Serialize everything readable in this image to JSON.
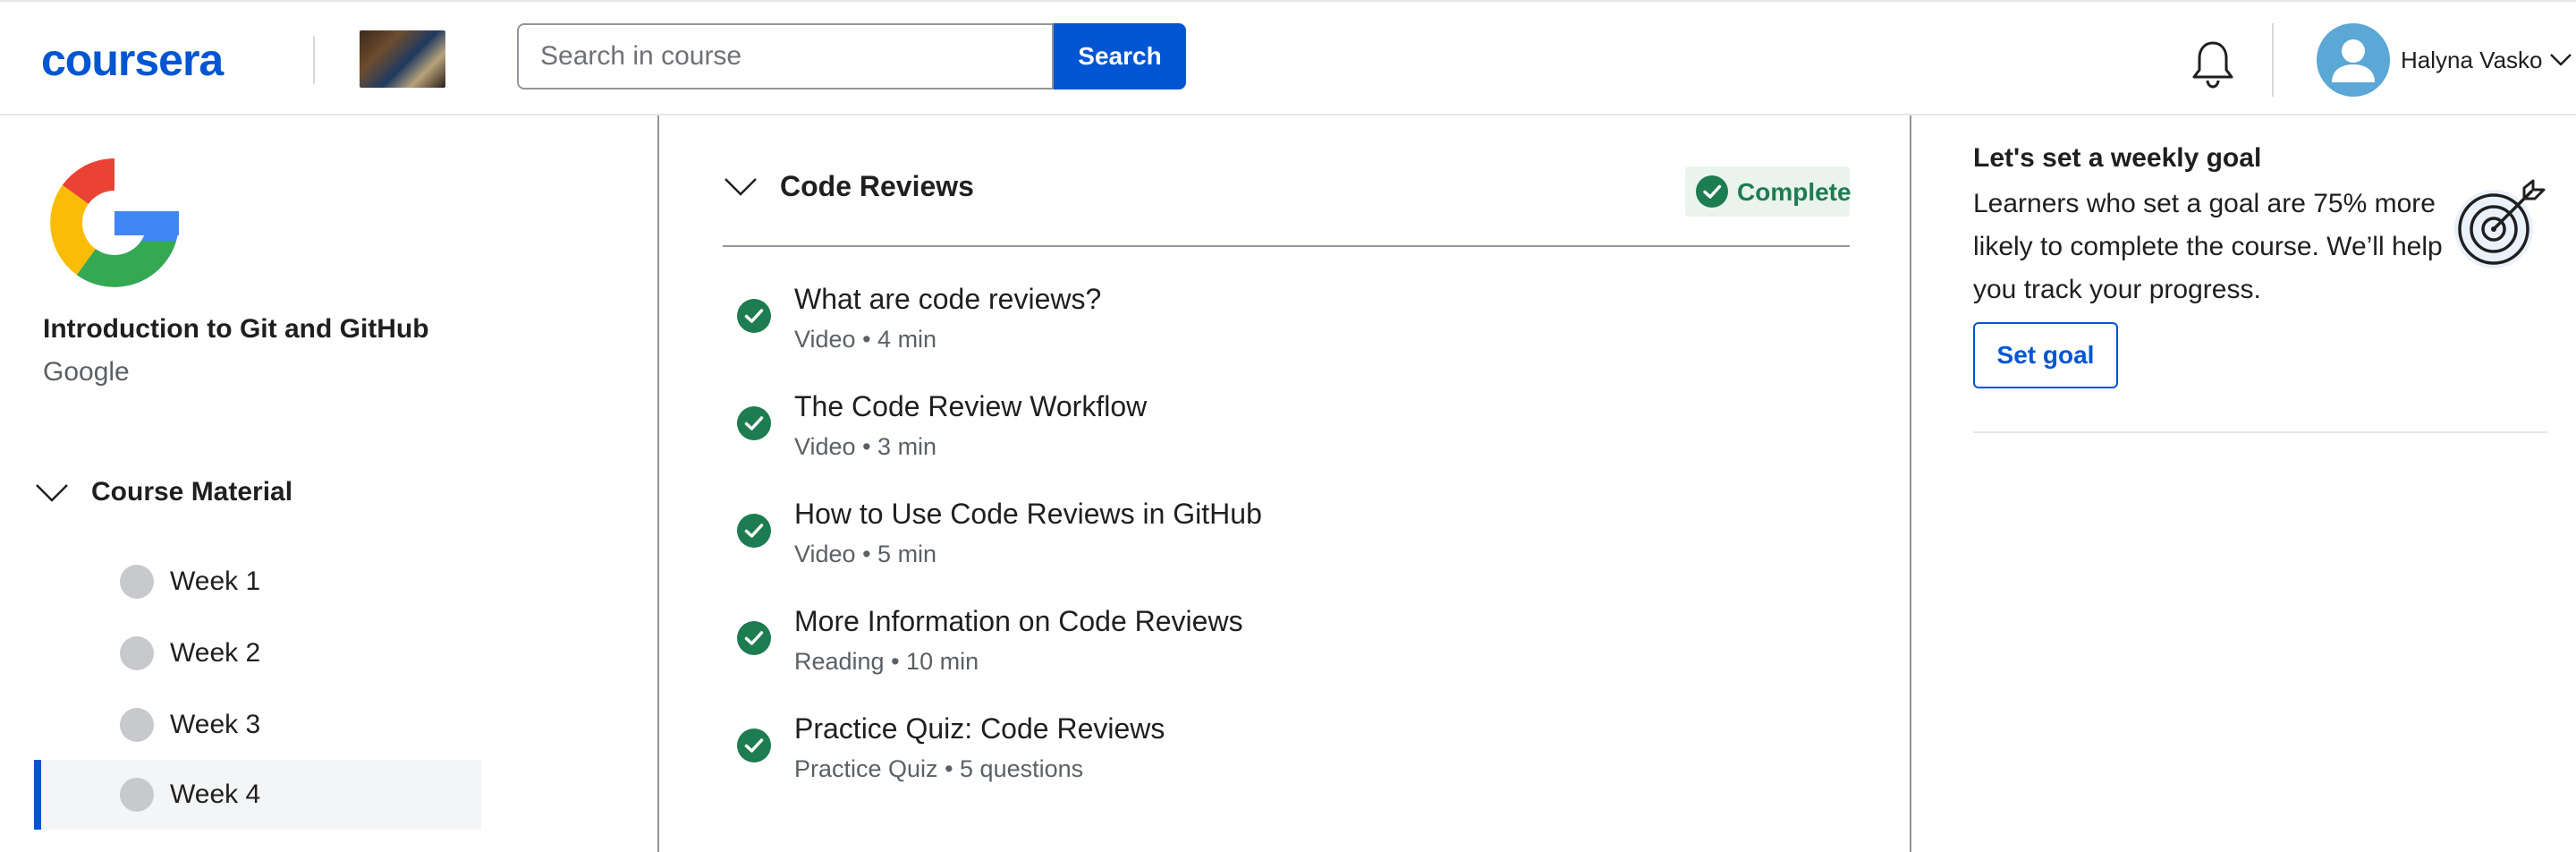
{
  "header": {
    "logo_text": "coursera",
    "search": {
      "placeholder": "Search in course",
      "value": "",
      "button_label": "Search"
    },
    "user": {
      "name": "Halyna Vasko"
    },
    "brand_color": "#0056d2"
  },
  "sidebar": {
    "course_title": "Introduction to Git and GitHub",
    "course_org": "Google",
    "material_label": "Course Material",
    "weeks": [
      {
        "label": "Week 1",
        "active": false
      },
      {
        "label": "Week 2",
        "active": false
      },
      {
        "label": "Week 3",
        "active": false
      },
      {
        "label": "Week 4",
        "active": true
      }
    ]
  },
  "main": {
    "section_title": "Code Reviews",
    "status_label": "Complete",
    "status_color": "#1d7c50",
    "items": [
      {
        "title": "What are code reviews?",
        "type": "Video",
        "detail": "4 min",
        "completed": true
      },
      {
        "title": "The Code Review Workflow",
        "type": "Video",
        "detail": "3 min",
        "completed": true
      },
      {
        "title": "How to Use Code Reviews in GitHub",
        "type": "Video",
        "detail": "5 min",
        "completed": true
      },
      {
        "title": "More Information on Code Reviews",
        "type": "Reading",
        "detail": "10 min",
        "completed": true
      },
      {
        "title": "Practice Quiz: Code Reviews",
        "type": "Practice Quiz",
        "detail": "5 questions",
        "completed": true
      }
    ]
  },
  "goal": {
    "title": "Let's set a weekly goal",
    "description": "Learners who set a goal are 75% more likely to complete the course. We’ll help you track your progress.",
    "button_label": "Set goal"
  }
}
